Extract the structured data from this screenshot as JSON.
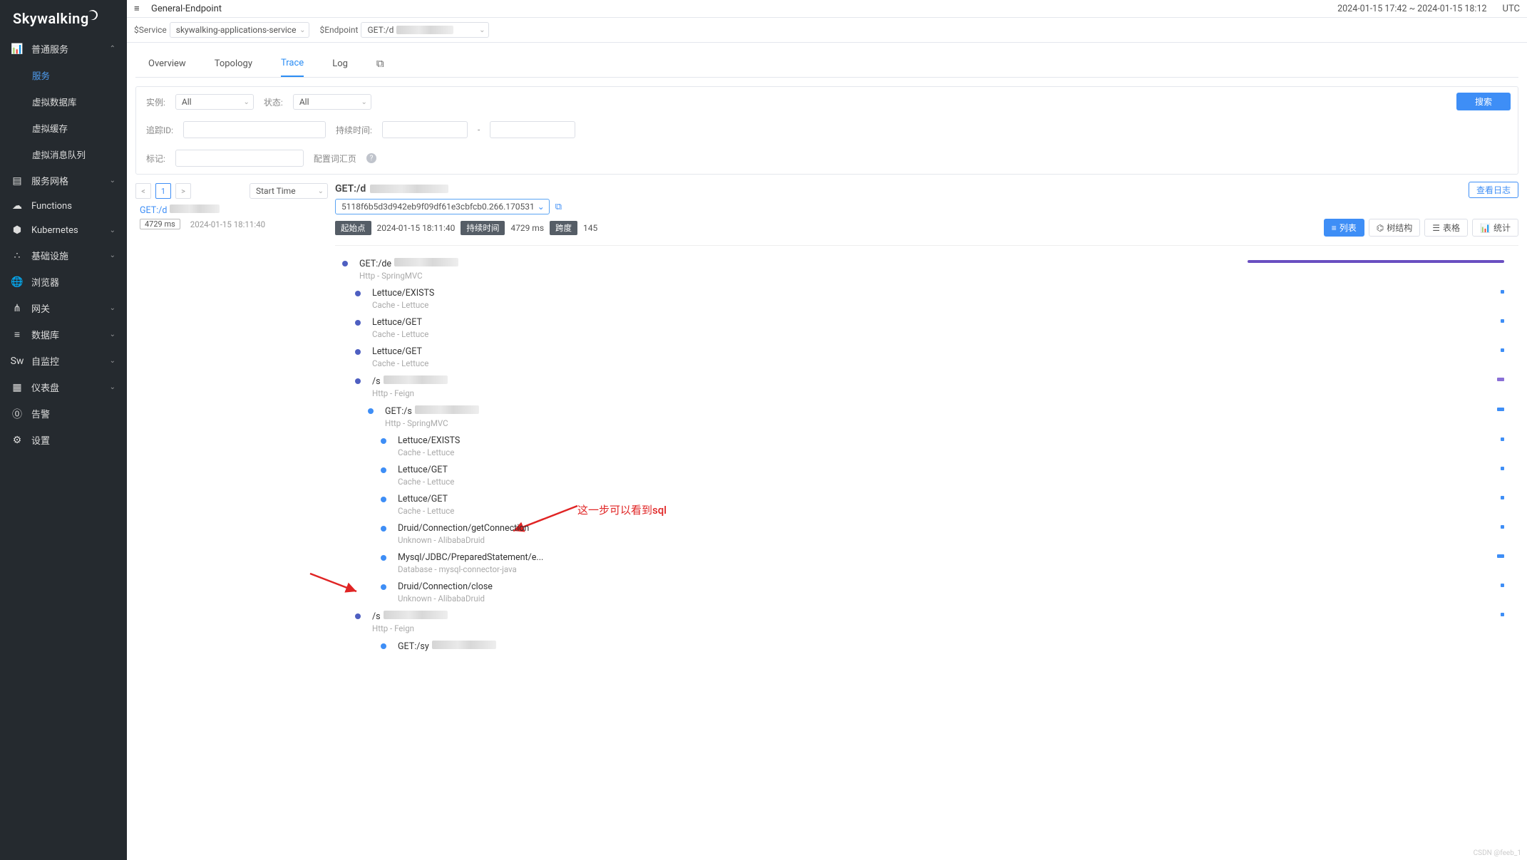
{
  "brand": "Skywalking",
  "header": {
    "collapse_icon": "≡",
    "title": "General-Endpoint",
    "time_range": "2024-01-15 17:42 ~ 2024-01-15 18:12",
    "tz": "UTC"
  },
  "selectors": {
    "service_label": "$Service",
    "service_value": "skywalking-applications-service",
    "endpoint_label": "$Endpoint",
    "endpoint_value": "GET:/d"
  },
  "sidebar": {
    "sections": [
      {
        "label": "普通服务",
        "icon": "chart",
        "expanded": true,
        "children": [
          {
            "label": "服务",
            "active": true
          },
          {
            "label": "虚拟数据库"
          },
          {
            "label": "虚拟缓存"
          },
          {
            "label": "虚拟消息队列"
          }
        ]
      },
      {
        "label": "服务网格",
        "icon": "mesh",
        "expanded": false
      },
      {
        "label": "Functions",
        "icon": "cloud",
        "expanded": null
      },
      {
        "label": "Kubernetes",
        "icon": "k8s",
        "expanded": false
      },
      {
        "label": "基础设施",
        "icon": "infra",
        "expanded": false
      },
      {
        "label": "浏览器",
        "icon": "globe",
        "expanded": null
      },
      {
        "label": "网关",
        "icon": "gateway",
        "expanded": false
      },
      {
        "label": "数据库",
        "icon": "db",
        "expanded": false
      },
      {
        "label": "自监控",
        "icon": "sw",
        "expanded": false
      },
      {
        "label": "仪表盘",
        "icon": "dash",
        "expanded": false
      },
      {
        "label": "告警",
        "icon": "alert",
        "expanded": null
      },
      {
        "label": "设置",
        "icon": "gear",
        "expanded": null
      }
    ]
  },
  "tabs": [
    {
      "label": "Overview"
    },
    {
      "label": "Topology"
    },
    {
      "label": "Trace",
      "active": true
    },
    {
      "label": "Log"
    },
    {
      "label": "",
      "icon": "copy"
    }
  ],
  "filters": {
    "instance_label": "实例:",
    "instance_value": "All",
    "status_label": "状态:",
    "status_value": "All",
    "traceid_label": "追踪ID:",
    "duration_label": "持续时间:",
    "duration_sep": "-",
    "tags_label": "标记:",
    "vocab_label": "配置词汇页",
    "search_btn": "搜索"
  },
  "pager": {
    "prev": "<",
    "page": "1",
    "next": ">",
    "sort": "Start Time"
  },
  "trace_item": {
    "name": "GET:/d",
    "duration": "4729 ms",
    "time": "2024-01-15 18:11:40"
  },
  "trace_detail": {
    "title": "GET:/d",
    "view_log_btn": "查看日志",
    "trace_id": "5118f6b5d3d942eb9f09df61e3cbfcb0.266.170531",
    "start_label": "起始点",
    "start_value": "2024-01-15 18:11:40",
    "duration_label": "持续时间",
    "duration_value": "4729 ms",
    "span_label": "跨度",
    "span_value": "145",
    "views": {
      "list": "列表",
      "tree": "树结构",
      "table": "表格",
      "stats": "统计"
    }
  },
  "spans": [
    {
      "name": "GET:/de",
      "sub": "Http - SpringMVC",
      "indent": 0,
      "color": "purple",
      "blur": true,
      "bar": "wide-purple"
    },
    {
      "name": "Lettuce/EXISTS",
      "sub": "Cache - Lettuce",
      "indent": 1,
      "color": "purple",
      "bar": "dot-blue"
    },
    {
      "name": "Lettuce/GET",
      "sub": "Cache - Lettuce",
      "indent": 1,
      "color": "purple",
      "bar": "dot-blue"
    },
    {
      "name": "Lettuce/GET",
      "sub": "Cache - Lettuce",
      "indent": 1,
      "color": "purple",
      "bar": "dot-blue"
    },
    {
      "name": "/s",
      "sub": "Http - Feign",
      "indent": 1,
      "color": "purple",
      "blur": true,
      "bar": "short-purple"
    },
    {
      "name": "GET:/s",
      "sub": "Http - SpringMVC",
      "indent": 2,
      "color": "blue",
      "blur": true,
      "bar": "short-blue"
    },
    {
      "name": "Lettuce/EXISTS",
      "sub": "Cache - Lettuce",
      "indent": 3,
      "color": "blue",
      "bar": "dot-blue"
    },
    {
      "name": "Lettuce/GET",
      "sub": "Cache - Lettuce",
      "indent": 3,
      "color": "blue",
      "bar": "dot-blue"
    },
    {
      "name": "Lettuce/GET",
      "sub": "Cache - Lettuce",
      "indent": 3,
      "color": "blue",
      "bar": "dot-blue"
    },
    {
      "name": "Druid/Connection/getConnection",
      "sub": "Unknown - AlibabaDruid",
      "indent": 3,
      "color": "blue",
      "bar": "dot-blue"
    },
    {
      "name": "Mysql/JDBC/PreparedStatement/e...",
      "sub": "Database - mysql-connector-java",
      "indent": 3,
      "color": "blue",
      "bar": "short-blue"
    },
    {
      "name": "Druid/Connection/close",
      "sub": "Unknown - AlibabaDruid",
      "indent": 3,
      "color": "blue",
      "bar": "dot-blue"
    },
    {
      "name": "/s",
      "sub": "Http - Feign",
      "indent": 1,
      "color": "purple",
      "blur": true,
      "bar": "dot-blue"
    },
    {
      "name": "GET:/sy",
      "sub": "",
      "indent": 3,
      "color": "blue",
      "blur": true,
      "bar": ""
    }
  ],
  "annotation": "这一步可以看到sql",
  "watermark": "CSDN @feeb_1"
}
